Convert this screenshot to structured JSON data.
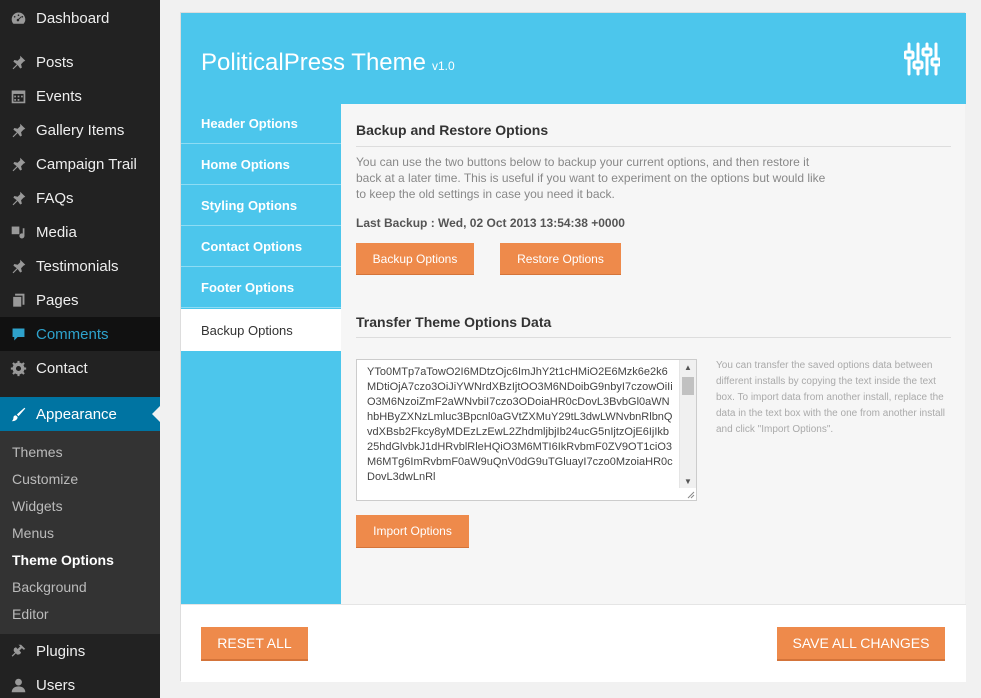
{
  "colors": {
    "accent": "#4cc6ec",
    "button": "#ee8a4b",
    "sidebar_bg": "#222222",
    "sidebar_active": "#0074a2"
  },
  "sidebar": {
    "menu": [
      {
        "label": "Dashboard",
        "icon": "dashboard-icon"
      },
      {
        "label": "Posts",
        "icon": "pin-icon"
      },
      {
        "label": "Events",
        "icon": "calendar-icon"
      },
      {
        "label": "Gallery Items",
        "icon": "pin-icon"
      },
      {
        "label": "Campaign Trail",
        "icon": "pin-icon"
      },
      {
        "label": "FAQs",
        "icon": "pin-icon"
      },
      {
        "label": "Media",
        "icon": "media-icon"
      },
      {
        "label": "Testimonials",
        "icon": "pin-icon"
      },
      {
        "label": "Pages",
        "icon": "pages-icon"
      },
      {
        "label": "Comments",
        "icon": "comment-icon"
      },
      {
        "label": "Contact",
        "icon": "gear-icon"
      },
      {
        "label": "Appearance",
        "icon": "paintbrush-icon"
      }
    ],
    "submenu": [
      "Themes",
      "Customize",
      "Widgets",
      "Menus",
      "Theme Options",
      "Background",
      "Editor"
    ],
    "submenu_current": "Theme Options",
    "after": [
      {
        "label": "Plugins",
        "icon": "plugin-icon"
      },
      {
        "label": "Users",
        "icon": "users-icon"
      }
    ]
  },
  "panel": {
    "title": "PoliticalPress Theme",
    "version": "v1.0",
    "tabs": [
      "Header Options",
      "Home Options",
      "Styling Options",
      "Contact Options",
      "Footer Options",
      "Backup Options"
    ],
    "active_tab": "Backup Options"
  },
  "backup": {
    "title": "Backup and Restore Options",
    "description": "You can use the two buttons below to backup your current options, and then restore it back at a later time. This is useful if you want to experiment on the options but would like to keep the old settings in case you need it back.",
    "last_backup": "Last Backup : Wed, 02 Oct 2013 13:54:38 +0000",
    "backup_button": "Backup Options",
    "restore_button": "Restore Options"
  },
  "transfer": {
    "title": "Transfer Theme Options Data",
    "data": "YTo0MTp7aTowO2I6MDtzOjc6ImJhY2t1cHMiO2E6Mzk6e2k6MDtiOjA7czo3OiJiYWNrdXBzIjtOO3M6NDoibG9nbyI7czowOiIiO3M6NzoiZmF2aWNvbiI7czo3ODoiaHR0cDovL3BvbGl0aWNhbHByZXNzLmluc3Bpcnl0aGVtZXMuY29tL3dwLWNvbnRlbnQvdXBsb2Fkcy8yMDEzLzEwL2ZhdmljbjIb24ucG5nIjtzOjE6IjIkb25hdGlvbkJ1dHRvblRleHQiO3M6MTI6IkRvbmF0ZV9OT1ciO3M6MTg6ImRvbmF0aW9uQnV0dG9uTGluayI7czo0MzoiaHR0cDovL3dwLnRl",
    "help": "You can transfer the saved options data between different installs by copying the text inside the text box. To import data from another install, replace the data in the text box with the one from another install and click \"Import Options\".",
    "import_button": "Import Options"
  },
  "footer": {
    "reset_button": "RESET ALL",
    "save_button": "SAVE ALL CHANGES"
  }
}
